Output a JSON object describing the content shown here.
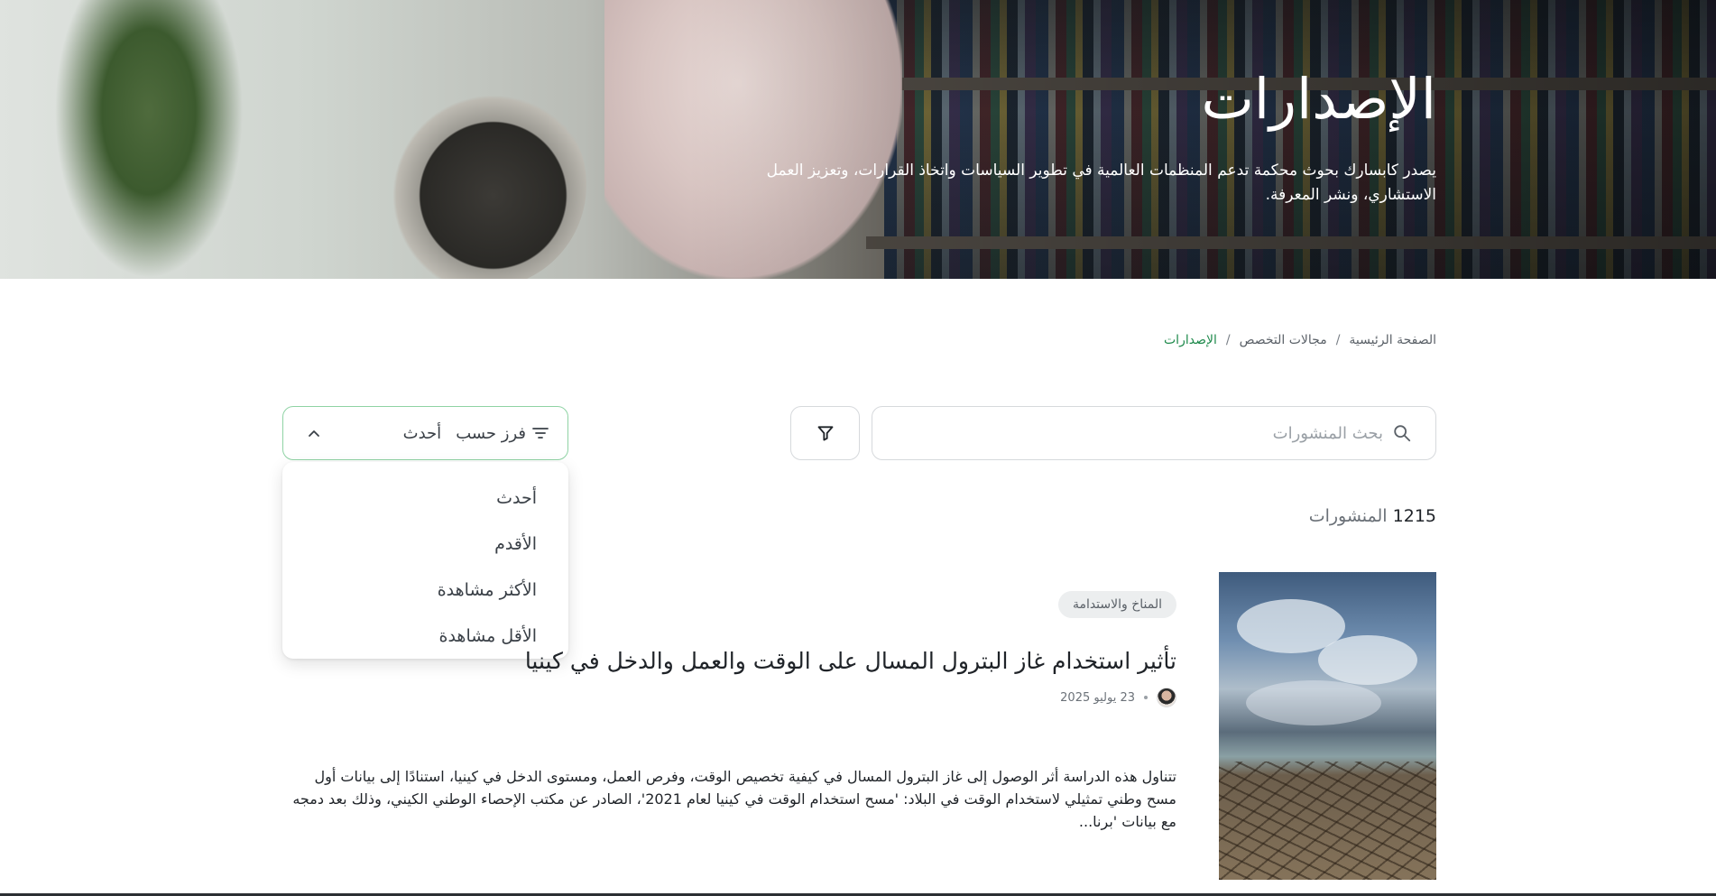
{
  "hero": {
    "title": "الإصدارات",
    "description": "يصدر كابسارك بحوث محكمة تدعم المنظمات العالمية في تطوير السياسات واتخاذ القرارات، وتعزيز العمل الاستشاري، ونشر المعرفة."
  },
  "breadcrumb": {
    "items": [
      "الصفحة الرئيسية",
      "مجالات التخصص",
      "الإصدارات"
    ],
    "separator": "/"
  },
  "search": {
    "placeholder": "بحث المنشورات",
    "icon": "search-icon"
  },
  "filter": {
    "icon": "funnel-icon"
  },
  "sort": {
    "label": "فرز حسب",
    "selected": "أحدث",
    "icon": "sort-lines-icon",
    "chevron": "chevron-up-icon",
    "options": [
      "أحدث",
      "الأقدم",
      "الأكثر مشاهدة",
      "الأقل مشاهدة"
    ]
  },
  "results": {
    "count": "1215",
    "label": "المنشورات"
  },
  "publication": {
    "tag": "المناخ والاستدامة",
    "title": "تأثير استخدام غاز البترول المسال على الوقت والعمل والدخل في كينيا",
    "date": "23 يوليو 2025",
    "excerpt": "تتناول هذه الدراسة أثر الوصول إلى غاز البترول المسال في كيفية تخصيص الوقت، وفرص العمل، ومستوى الدخل في كينيا، استنادًا إلى بيانات أول مسح وطني تمثيلي لاستخدام الوقت في البلاد: 'مسح استخدام الوقت في كينيا لعام 2021'، الصادر عن مكتب الإحصاء الوطني الكيني، وذلك بعد دمجه مع بيانات 'برنا..."
  },
  "colors": {
    "accent_green": "#1f8a4c",
    "sort_border": "#8fd3a4"
  }
}
